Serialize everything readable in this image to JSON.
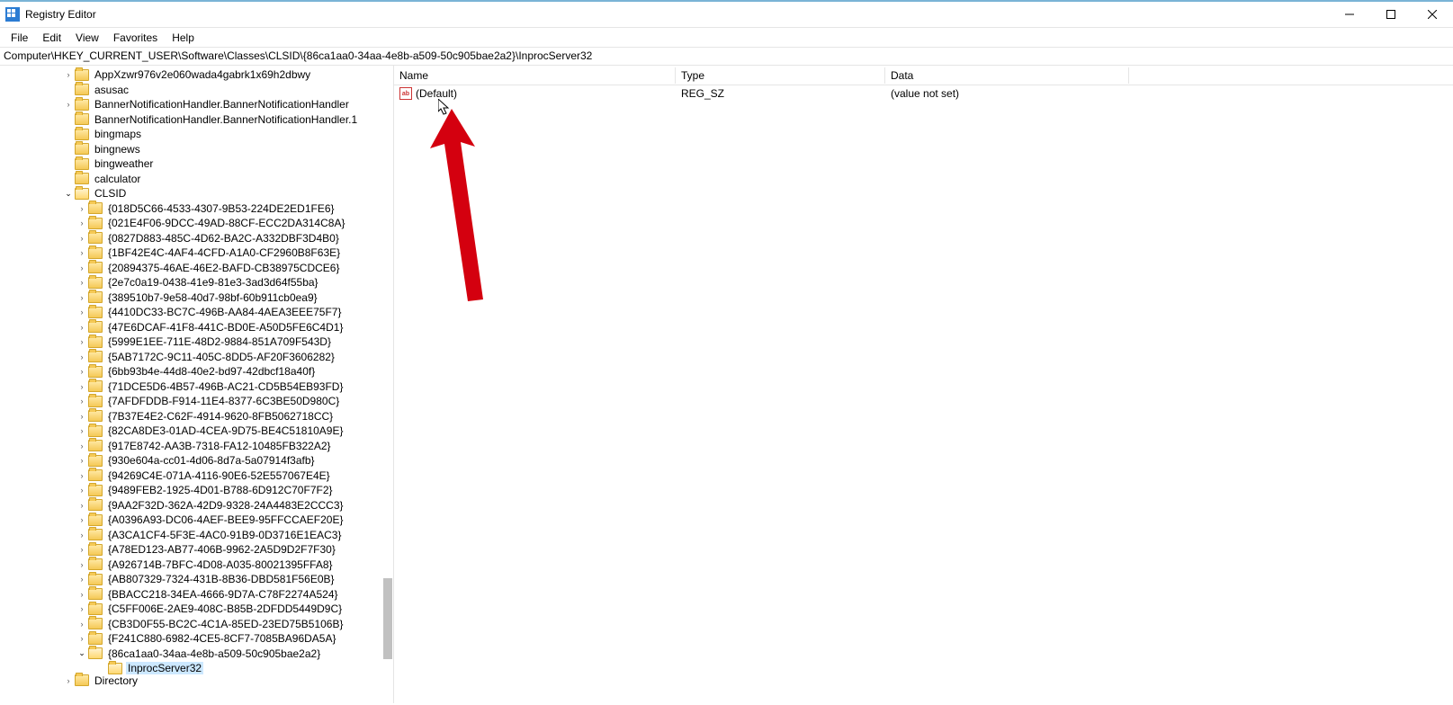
{
  "window": {
    "title": "Registry Editor"
  },
  "menu": {
    "items": [
      "File",
      "Edit",
      "View",
      "Favorites",
      "Help"
    ]
  },
  "address": "Computer\\HKEY_CURRENT_USER\\Software\\Classes\\CLSID\\{86ca1aa0-34aa-4e8b-a509-50c905bae2a2}\\InprocServer32",
  "tree": [
    {
      "indent": 71,
      "chevron": ">",
      "label": "AppXzwr976v2e060wada4gabrk1x69h2dbwy"
    },
    {
      "indent": 71,
      "chevron": "",
      "label": "asusac"
    },
    {
      "indent": 71,
      "chevron": ">",
      "label": "BannerNotificationHandler.BannerNotificationHandler"
    },
    {
      "indent": 71,
      "chevron": "",
      "label": "BannerNotificationHandler.BannerNotificationHandler.1"
    },
    {
      "indent": 71,
      "chevron": "",
      "label": "bingmaps"
    },
    {
      "indent": 71,
      "chevron": "",
      "label": "bingnews"
    },
    {
      "indent": 71,
      "chevron": "",
      "label": "bingweather"
    },
    {
      "indent": 71,
      "chevron": "",
      "label": "calculator"
    },
    {
      "indent": 71,
      "chevron": "v",
      "label": "CLSID",
      "open": true
    },
    {
      "indent": 86,
      "chevron": ">",
      "label": "{018D5C66-4533-4307-9B53-224DE2ED1FE6}"
    },
    {
      "indent": 86,
      "chevron": ">",
      "label": "{021E4F06-9DCC-49AD-88CF-ECC2DA314C8A}"
    },
    {
      "indent": 86,
      "chevron": ">",
      "label": "{0827D883-485C-4D62-BA2C-A332DBF3D4B0}"
    },
    {
      "indent": 86,
      "chevron": ">",
      "label": "{1BF42E4C-4AF4-4CFD-A1A0-CF2960B8F63E}"
    },
    {
      "indent": 86,
      "chevron": ">",
      "label": "{20894375-46AE-46E2-BAFD-CB38975CDCE6}"
    },
    {
      "indent": 86,
      "chevron": ">",
      "label": "{2e7c0a19-0438-41e9-81e3-3ad3d64f55ba}"
    },
    {
      "indent": 86,
      "chevron": ">",
      "label": "{389510b7-9e58-40d7-98bf-60b911cb0ea9}"
    },
    {
      "indent": 86,
      "chevron": ">",
      "label": "{4410DC33-BC7C-496B-AA84-4AEA3EEE75F7}"
    },
    {
      "indent": 86,
      "chevron": ">",
      "label": "{47E6DCAF-41F8-441C-BD0E-A50D5FE6C4D1}"
    },
    {
      "indent": 86,
      "chevron": ">",
      "label": "{5999E1EE-711E-48D2-9884-851A709F543D}"
    },
    {
      "indent": 86,
      "chevron": ">",
      "label": "{5AB7172C-9C11-405C-8DD5-AF20F3606282}"
    },
    {
      "indent": 86,
      "chevron": ">",
      "label": "{6bb93b4e-44d8-40e2-bd97-42dbcf18a40f}"
    },
    {
      "indent": 86,
      "chevron": ">",
      "label": "{71DCE5D6-4B57-496B-AC21-CD5B54EB93FD}"
    },
    {
      "indent": 86,
      "chevron": ">",
      "label": "{7AFDFDDB-F914-11E4-8377-6C3BE50D980C}"
    },
    {
      "indent": 86,
      "chevron": ">",
      "label": "{7B37E4E2-C62F-4914-9620-8FB5062718CC}"
    },
    {
      "indent": 86,
      "chevron": ">",
      "label": "{82CA8DE3-01AD-4CEA-9D75-BE4C51810A9E}"
    },
    {
      "indent": 86,
      "chevron": ">",
      "label": "{917E8742-AA3B-7318-FA12-10485FB322A2}"
    },
    {
      "indent": 86,
      "chevron": ">",
      "label": "{930e604a-cc01-4d06-8d7a-5a07914f3afb}"
    },
    {
      "indent": 86,
      "chevron": ">",
      "label": "{94269C4E-071A-4116-90E6-52E557067E4E}"
    },
    {
      "indent": 86,
      "chevron": ">",
      "label": "{9489FEB2-1925-4D01-B788-6D912C70F7F2}"
    },
    {
      "indent": 86,
      "chevron": ">",
      "label": "{9AA2F32D-362A-42D9-9328-24A4483E2CCC3}"
    },
    {
      "indent": 86,
      "chevron": ">",
      "label": "{A0396A93-DC06-4AEF-BEE9-95FFCCAEF20E}"
    },
    {
      "indent": 86,
      "chevron": ">",
      "label": "{A3CA1CF4-5F3E-4AC0-91B9-0D3716E1EAC3}"
    },
    {
      "indent": 86,
      "chevron": ">",
      "label": "{A78ED123-AB77-406B-9962-2A5D9D2F7F30}"
    },
    {
      "indent": 86,
      "chevron": ">",
      "label": "{A926714B-7BFC-4D08-A035-80021395FFA8}"
    },
    {
      "indent": 86,
      "chevron": ">",
      "label": "{AB807329-7324-431B-8B36-DBD581F56E0B}"
    },
    {
      "indent": 86,
      "chevron": ">",
      "label": "{BBACC218-34EA-4666-9D7A-C78F2274A524}"
    },
    {
      "indent": 86,
      "chevron": ">",
      "label": "{C5FF006E-2AE9-408C-B85B-2DFDD5449D9C}"
    },
    {
      "indent": 86,
      "chevron": ">",
      "label": "{CB3D0F55-BC2C-4C1A-85ED-23ED75B5106B}"
    },
    {
      "indent": 86,
      "chevron": ">",
      "label": "{F241C880-6982-4CE5-8CF7-7085BA96DA5A}"
    },
    {
      "indent": 86,
      "chevron": "v",
      "label": "{86ca1aa0-34aa-4e8b-a509-50c905bae2a2}",
      "open": true
    },
    {
      "indent": 108,
      "chevron": "",
      "label": "InprocServer32",
      "open": true,
      "selected": true
    },
    {
      "indent": 71,
      "chevron": ">",
      "label": "Directory",
      "cut": true
    }
  ],
  "list": {
    "headers": {
      "name": "Name",
      "type": "Type",
      "data": "Data"
    },
    "rows": [
      {
        "name": "(Default)",
        "type": "REG_SZ",
        "data": "(value not set)"
      }
    ]
  }
}
